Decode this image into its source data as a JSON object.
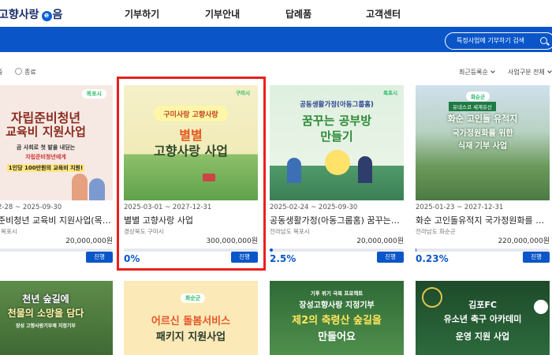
{
  "header": {
    "logo_text": "고향사랑",
    "logo_suffix": "음",
    "nav": [
      "기부하기",
      "기부안내",
      "답례품",
      "고객센터"
    ]
  },
  "banner": {
    "search_button": "특정사업에 기부하기 검색"
  },
  "filters": {
    "options": [
      "중",
      "종료"
    ],
    "sort": "최근등록순",
    "category": "사업구분 전체"
  },
  "cards": [
    {
      "thumb_lines": [
        "자립준비청년",
        "교육비 지원사업"
      ],
      "thumb_caption": "1인당 100만원의 교육비 지원!",
      "thumb_sub": "자립준비청년에게",
      "thumb_top": "곰 사회로 첫 발을 내딛는",
      "thumb_badge": "목포시",
      "date": "2-28 ~ 2025-09-30",
      "title": "준비청년 교육비 지원사업(목…",
      "region": "목포시",
      "amount": "20,000,000원",
      "progress_text": "",
      "progress": 0.0,
      "status": "진행"
    },
    {
      "thumb_top": "구미사랑 고향사랑",
      "thumb_lines": [
        "별별",
        "고향사랑 사업"
      ],
      "thumb_badge": "구미시",
      "date": "2025-03-01 ~ 2027-12-31",
      "title": "별별 고향사랑 사업",
      "region": "경상북도 구미시",
      "amount": "300,000,000원",
      "progress_text": "0%",
      "progress": 0.0,
      "status": "진행"
    },
    {
      "thumb_top": "공동생활가정(아동그룹홈)",
      "thumb_lines": [
        "꿈꾸는 공부방",
        "만들기"
      ],
      "thumb_badge": "목포시",
      "date": "2025-02-24 ~ 2025-09-30",
      "title": "공동생활가정(아동그룹홈) 꿈꾸는…",
      "region": "전라남도 목포시",
      "amount": "20,000,000원",
      "progress_text": "2.5%",
      "progress": 0.025,
      "status": "진행"
    },
    {
      "thumb_top": "유네스코 세계유산",
      "thumb_lines": [
        "화순 고인돌 유적지",
        "국가정원화를 위한",
        "식재 기부 사업"
      ],
      "thumb_badge": "화순군",
      "date": "2025-01-23 ~ 2027-12-31",
      "title": "화순 고인돌유적지 국가정원화를 …",
      "region": "전라남도 화순군",
      "amount": "220,000,000원",
      "progress_text": "0.23%",
      "progress": 0.0023,
      "status": "진행"
    }
  ],
  "cards_row2": [
    {
      "lines": [
        "천년 숲길에",
        "천물의 소망을 담다"
      ],
      "sub": "장성 고향사랑기부제 지정기부"
    },
    {
      "badge": "화순군",
      "lines": [
        "어르신 돌봄서비스",
        "패키지 지원사업"
      ]
    },
    {
      "top": "기후 위기 극복 프로젝트",
      "lines": [
        "장성고향사랑 지정기부",
        "제2의 축령산 숲길을",
        "만들어요"
      ]
    },
    {
      "lines": [
        "김포FC",
        "유소년 축구 아카데미",
        "운영 지원 사업"
      ]
    }
  ],
  "colors": {
    "brand_blue": "#0a56c9",
    "highlight_red": "#e8211d"
  }
}
